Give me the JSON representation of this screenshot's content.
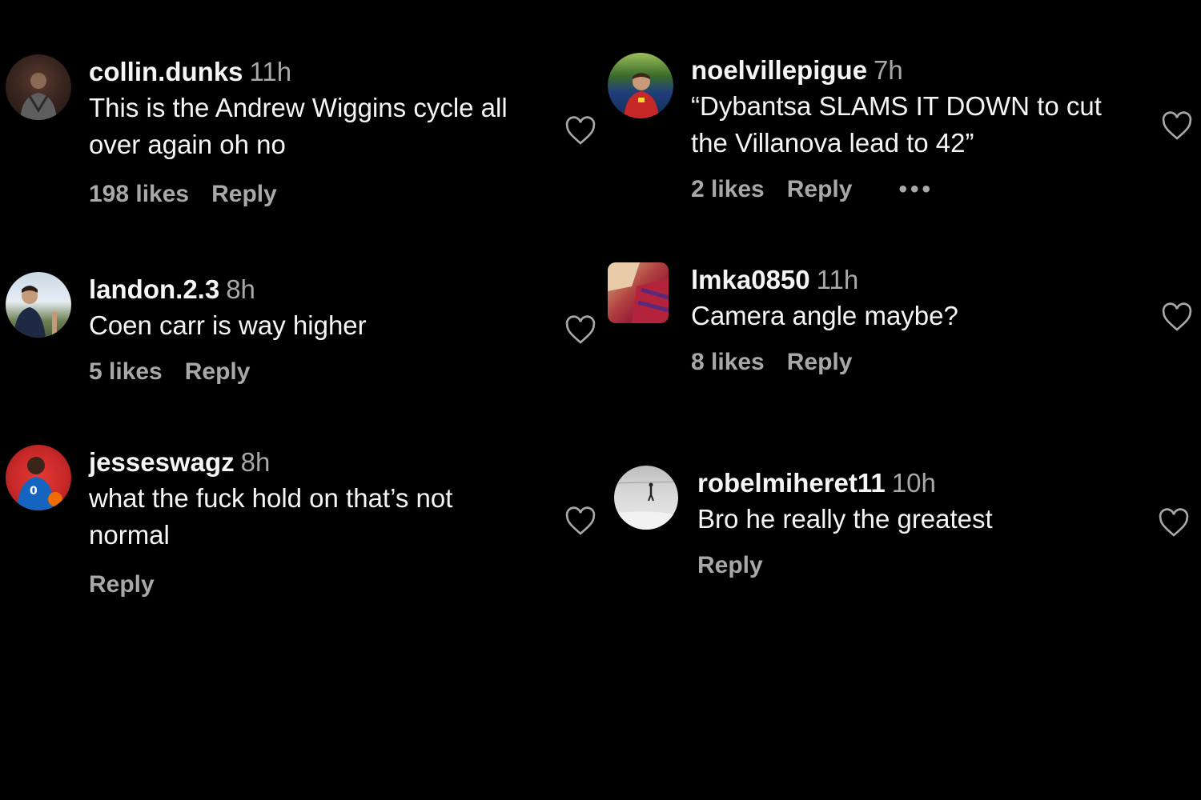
{
  "comments_left": [
    {
      "username": "collin.dunks",
      "time": "11h",
      "text_lines": [
        "This is the Andrew Wiggins cycle all",
        "over again oh no"
      ],
      "likes": "198 likes",
      "reply": "Reply"
    },
    {
      "username": "landon.2.3",
      "time": "8h",
      "text_lines": [
        "Coen carr is way higher"
      ],
      "likes": "5 likes",
      "reply": "Reply"
    },
    {
      "username": "jesseswagz",
      "time": "8h",
      "text_lines": [
        "what the fuck hold on that’s not",
        "normal"
      ],
      "likes": "",
      "reply": "Reply"
    }
  ],
  "comments_right": [
    {
      "username": "noelvillepigue",
      "time": "7h",
      "text_lines": [
        "“Dybantsa SLAMS IT DOWN to cut",
        "the Villanova lead to 42”"
      ],
      "likes": "2 likes",
      "reply": "Reply",
      "more": "•••"
    },
    {
      "username": "lmka0850",
      "time": "11h",
      "text_lines": [
        "Camera angle maybe?"
      ],
      "likes": "8 likes",
      "reply": "Reply"
    },
    {
      "username": "robelmiheret11",
      "time": "10h",
      "text_lines": [
        "Bro he really the greatest"
      ],
      "likes": "",
      "reply": "Reply"
    }
  ],
  "icons": {
    "like": "heart-outline-icon",
    "more": "more-options-icon"
  },
  "colors": {
    "background": "#000000",
    "primary_text": "#f5f5f5",
    "secondary_text": "#a8a8a8"
  }
}
